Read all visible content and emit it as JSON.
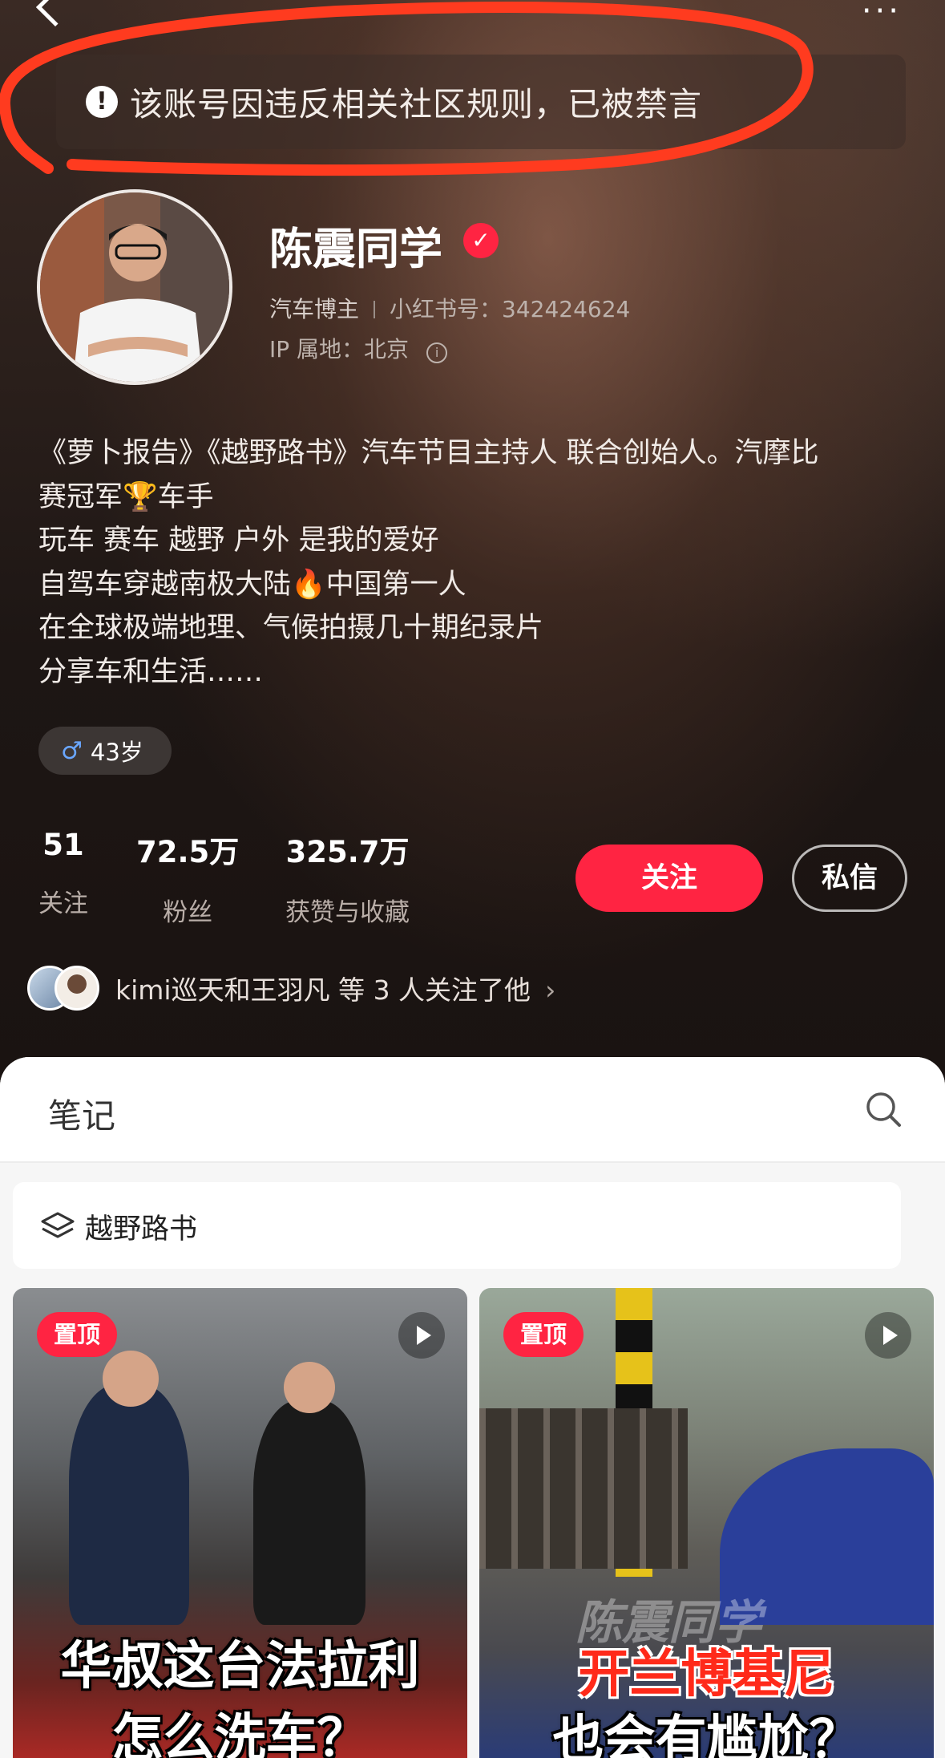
{
  "colors": {
    "accent": "#ff2442",
    "annotation_stroke": "#ff3b1f",
    "male_symbol": "#6aa7ff"
  },
  "banner": {
    "text": "该账号因违反相关社区规则，已被禁言",
    "icon": "exclamation-icon"
  },
  "profile": {
    "name": "陈震同学",
    "verified_icon": "verified-check-icon",
    "category": "汽车博主",
    "red_id": "小红书号：342424624",
    "ip": "IP 属地：北京",
    "bio": [
      "《萝卜报告》《越野路书》汽车节目主持人 联合创始人。汽摩比",
      "赛冠军🏆车手",
      "玩车 赛车 越野 户外 是我的爱好",
      "自驾车穿越南极大陆🔥中国第一人",
      "在全球极端地理、气候拍摄几十期纪录片",
      "分享车和生活……"
    ],
    "age_tag": "43岁"
  },
  "stats": [
    {
      "num": "51",
      "label": "关注"
    },
    {
      "num": "72.5万",
      "label": "粉丝"
    },
    {
      "num": "325.7万",
      "label": "获赞与收藏"
    }
  ],
  "buttons": {
    "follow": "关注",
    "message": "私信"
  },
  "mutual": {
    "text": "kimi巡天和王羽凡 等 3 人关注了他"
  },
  "tabs": {
    "notes": "笔记"
  },
  "album": {
    "name": "越野路书"
  },
  "cards": [
    {
      "pin": "置顶",
      "caption_line1": "华叔这台法拉利",
      "caption_line2": "怎么洗车？"
    },
    {
      "pin": "置顶",
      "watermark": "陈震同学",
      "caption_line1": "开兰博基尼",
      "caption_line2": "也会有尴尬？"
    }
  ]
}
